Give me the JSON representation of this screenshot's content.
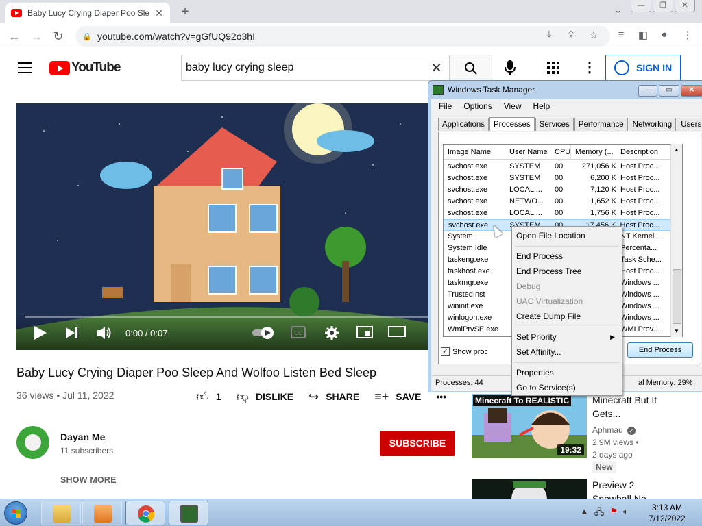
{
  "browser": {
    "tab_title": "Baby Lucy Crying Diaper Poo Sle",
    "tab_close": "✕",
    "new_tab": "+",
    "url": "youtube.com/watch?v=gGfUQ92o3hI",
    "window_controls": [
      "—",
      "❐",
      "✕"
    ]
  },
  "youtube": {
    "logo_text": "YouTube",
    "search_value": "baby lucy crying sleep",
    "sign_in_label": "SIGN IN",
    "video": {
      "time": "0:00 / 0:07",
      "title": "Baby Lucy Crying Diaper Poo Sleep And Wolfoo Listen Bed Sleep",
      "meta": "36 views • Jul 11, 2022",
      "like_count": "1",
      "dislike_label": "DISLIKE",
      "share_label": "SHARE",
      "save_label": "SAVE",
      "more_label": "•••",
      "progress": 0.0
    },
    "channel": {
      "name": "Dayan Me",
      "subscribers": "11 subscribers",
      "subscribe_label": "SUBSCRIBE",
      "show_more_label": "SHOW MORE"
    },
    "recommendations": [
      {
        "title_line1": "Minecraft But It",
        "title_line2": "Gets...",
        "channel": "Aphmau",
        "views": "2.9M views •",
        "age": "2 days ago",
        "badge": "New",
        "duration": "19:32",
        "thumb_text": "Minecraft To REALISTIC"
      },
      {
        "title_line1": "Preview 2",
        "title_line2": "Snowball No..."
      }
    ]
  },
  "task_manager": {
    "title": "Windows Task Manager",
    "menu": [
      "File",
      "Options",
      "View",
      "Help"
    ],
    "tabs": [
      "Applications",
      "Processes",
      "Services",
      "Performance",
      "Networking",
      "Users"
    ],
    "active_tab": "Processes",
    "columns": [
      "Image Name",
      "User Name",
      "CPU",
      "Memory (...",
      "Description"
    ],
    "rows": [
      [
        "svchost.exe",
        "SYSTEM",
        "00",
        "271,056 K",
        "Host Proc..."
      ],
      [
        "svchost.exe",
        "SYSTEM",
        "00",
        "6,200 K",
        "Host Proc..."
      ],
      [
        "svchost.exe",
        "LOCAL ...",
        "00",
        "7,120 K",
        "Host Proc..."
      ],
      [
        "svchost.exe",
        "NETWO...",
        "00",
        "1,652 K",
        "Host Proc..."
      ],
      [
        "svchost.exe",
        "LOCAL ...",
        "00",
        "1,756 K",
        "Host Proc..."
      ],
      [
        "svchost.exe",
        "SYSTEM",
        "00",
        "17,456 K",
        "Host Proc..."
      ],
      [
        "System",
        "",
        "",
        "",
        "NT Kernel..."
      ],
      [
        "System Idle",
        "",
        "",
        "",
        "Percenta..."
      ],
      [
        "taskeng.exe",
        "",
        "",
        "",
        "Task Sche..."
      ],
      [
        "taskhost.exe",
        "",
        "",
        "",
        "Host Proc..."
      ],
      [
        "taskmgr.exe",
        "",
        "",
        "",
        "Windows ..."
      ],
      [
        "TrustedInst",
        "",
        "",
        "",
        "Windows ..."
      ],
      [
        "wininit.exe",
        "",
        "",
        "",
        "Windows ..."
      ],
      [
        "winlogon.exe",
        "",
        "",
        "",
        "Windows ..."
      ],
      [
        "WmiPrvSE.exe",
        "",
        "",
        "",
        "WMI Prov..."
      ]
    ],
    "selected_row": 5,
    "show_processes_label": "Show proc",
    "end_process_label": "End Process",
    "status_processes": "Processes: 44",
    "status_memory": "al Memory: 29%"
  },
  "context_menu": {
    "items": [
      {
        "label": "Open File Location",
        "disabled": false
      },
      {
        "label": "End Process",
        "disabled": false
      },
      {
        "label": "End Process Tree",
        "disabled": false
      },
      {
        "label": "Debug",
        "disabled": true
      },
      {
        "label": "UAC Virtualization",
        "disabled": true
      },
      {
        "label": "Create Dump File",
        "disabled": false
      },
      {
        "label": "Set Priority",
        "disabled": false
      },
      {
        "label": "Set Affinity...",
        "disabled": false
      },
      {
        "label": "Properties",
        "disabled": false
      },
      {
        "label": "Go to Service(s)",
        "disabled": false
      }
    ]
  },
  "taskbar": {
    "time": "3:13 AM",
    "date": "7/12/2022"
  },
  "colors": {
    "youtube_red": "#ff0000",
    "subscribe_red": "#cc0000",
    "signin_blue": "#065fd4",
    "selection_blue": "#cde8ff"
  }
}
